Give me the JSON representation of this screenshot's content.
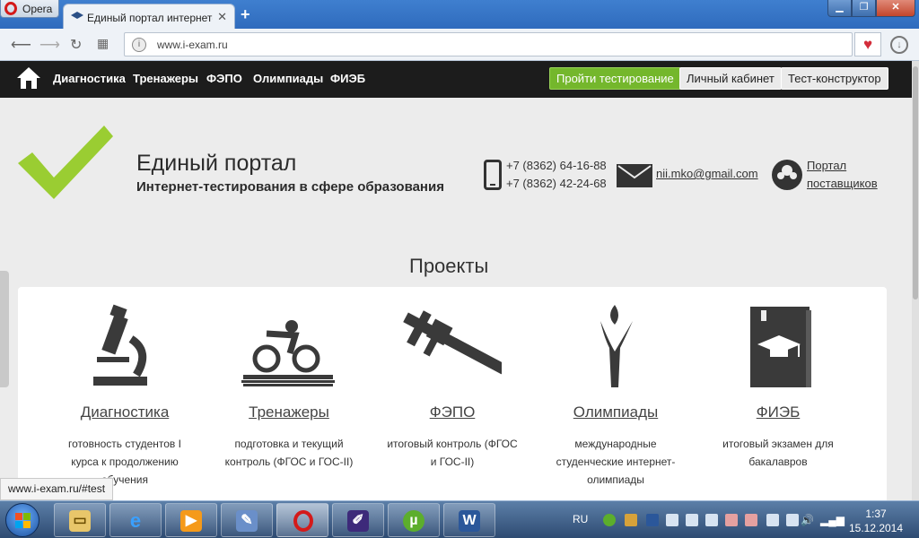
{
  "browser": {
    "menu_label": "Opera",
    "tab_title": "Единый портал интернет-",
    "tab_close": "✕",
    "new_tab": "+",
    "url": "www.i-exam.ru",
    "window_controls": {
      "minimize": "▁",
      "maximize": "❐",
      "close": "✕"
    }
  },
  "nav": {
    "links": [
      "Диагностика",
      "Тренажеры",
      "ФЭПО",
      "Олимпиады",
      "ФИЭБ"
    ],
    "buttons": [
      "Пройти тестирование",
      "Личный кабинет",
      "Тест-конструктор"
    ]
  },
  "header": {
    "title": "Единый портал",
    "subtitle": "Интернет-тестирования в сфере образования",
    "phone1": "+7 (8362) 64-16-88",
    "phone2": "+7 (8362) 42-24-68",
    "email": "nii.mko@gmail.com",
    "suppliers_line1": "Портал",
    "suppliers_line2": "поставщиков"
  },
  "projects": {
    "title": "Проекты",
    "items": [
      {
        "name": "Диагностика",
        "icon": "microscope-icon",
        "desc": "готовность студентов I курса к продолжению обучения"
      },
      {
        "name": "Тренажеры",
        "icon": "cyclist-icon",
        "desc": "подготовка и текущий контроль (ФГОС и ГОС-II)"
      },
      {
        "name": "ФЭПО",
        "icon": "caliper-icon",
        "desc": "итоговый контроль (ФГОС и ГОС-II)"
      },
      {
        "name": "Олимпиады",
        "icon": "torch-person-icon",
        "desc": "международные студенческие интернет-олимпиады"
      },
      {
        "name": "ФИЭБ",
        "icon": "graduation-book-icon",
        "desc": "итоговый экзамен для бакалавров"
      }
    ]
  },
  "status_link": "www.i-exam.ru/#test",
  "taskbar": {
    "language": "RU",
    "time": "1:37",
    "date": "15.12.2014"
  },
  "colors": {
    "accent_green": "#74b72c",
    "logo_green": "#9acd32",
    "dark_nav": "#1c1c1c"
  }
}
